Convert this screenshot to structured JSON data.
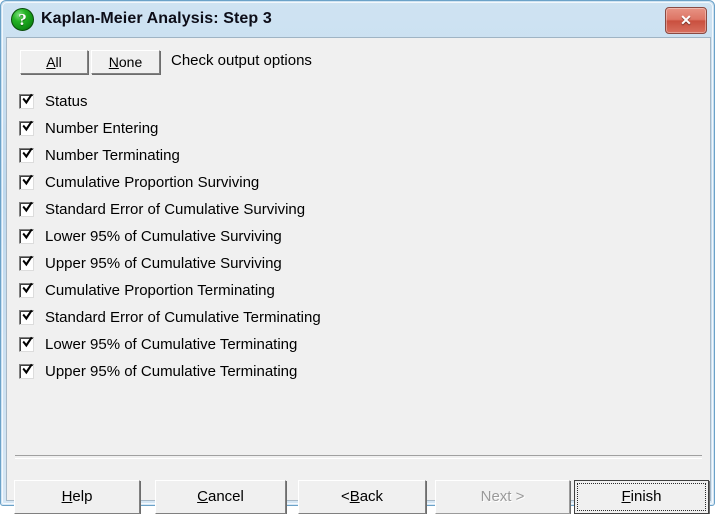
{
  "window": {
    "title": "Kaplan-Meier Analysis: Step 3",
    "icon": "green-question-sphere-icon",
    "close_label": "✕",
    "titlebar_color": "#bfd9ee",
    "body_color": "#f0f0f0"
  },
  "toolbar": {
    "all_prefix": "A",
    "all_rest": "ll",
    "none_prefix": "N",
    "none_rest": "one",
    "instruction": "Check output options"
  },
  "options": [
    {
      "label": "Status",
      "checked": true
    },
    {
      "label": "Number Entering",
      "checked": true
    },
    {
      "label": "Number Terminating",
      "checked": true
    },
    {
      "label": "Cumulative Proportion Surviving",
      "checked": true
    },
    {
      "label": "Standard Error of Cumulative Surviving",
      "checked": true
    },
    {
      "label": "Lower 95% of Cumulative Surviving",
      "checked": true
    },
    {
      "label": "Upper 95% of Cumulative Surviving",
      "checked": true
    },
    {
      "label": "Cumulative Proportion Terminating",
      "checked": true
    },
    {
      "label": "Standard Error of Cumulative Terminating",
      "checked": true
    },
    {
      "label": "Lower 95% of Cumulative Terminating",
      "checked": true
    },
    {
      "label": "Upper 95% of Cumulative Terminating",
      "checked": true
    }
  ],
  "footer": {
    "help_prefix": "H",
    "help_rest": "elp",
    "cancel_prefix": "C",
    "cancel_rest": "ancel",
    "back_lead": "< ",
    "back_prefix": "B",
    "back_rest": "ack",
    "next_lead": "",
    "next_prefix": "N",
    "next_rest": "ext >",
    "next_enabled": false,
    "finish_prefix": "F",
    "finish_rest": "inish",
    "finish_is_default": true
  }
}
